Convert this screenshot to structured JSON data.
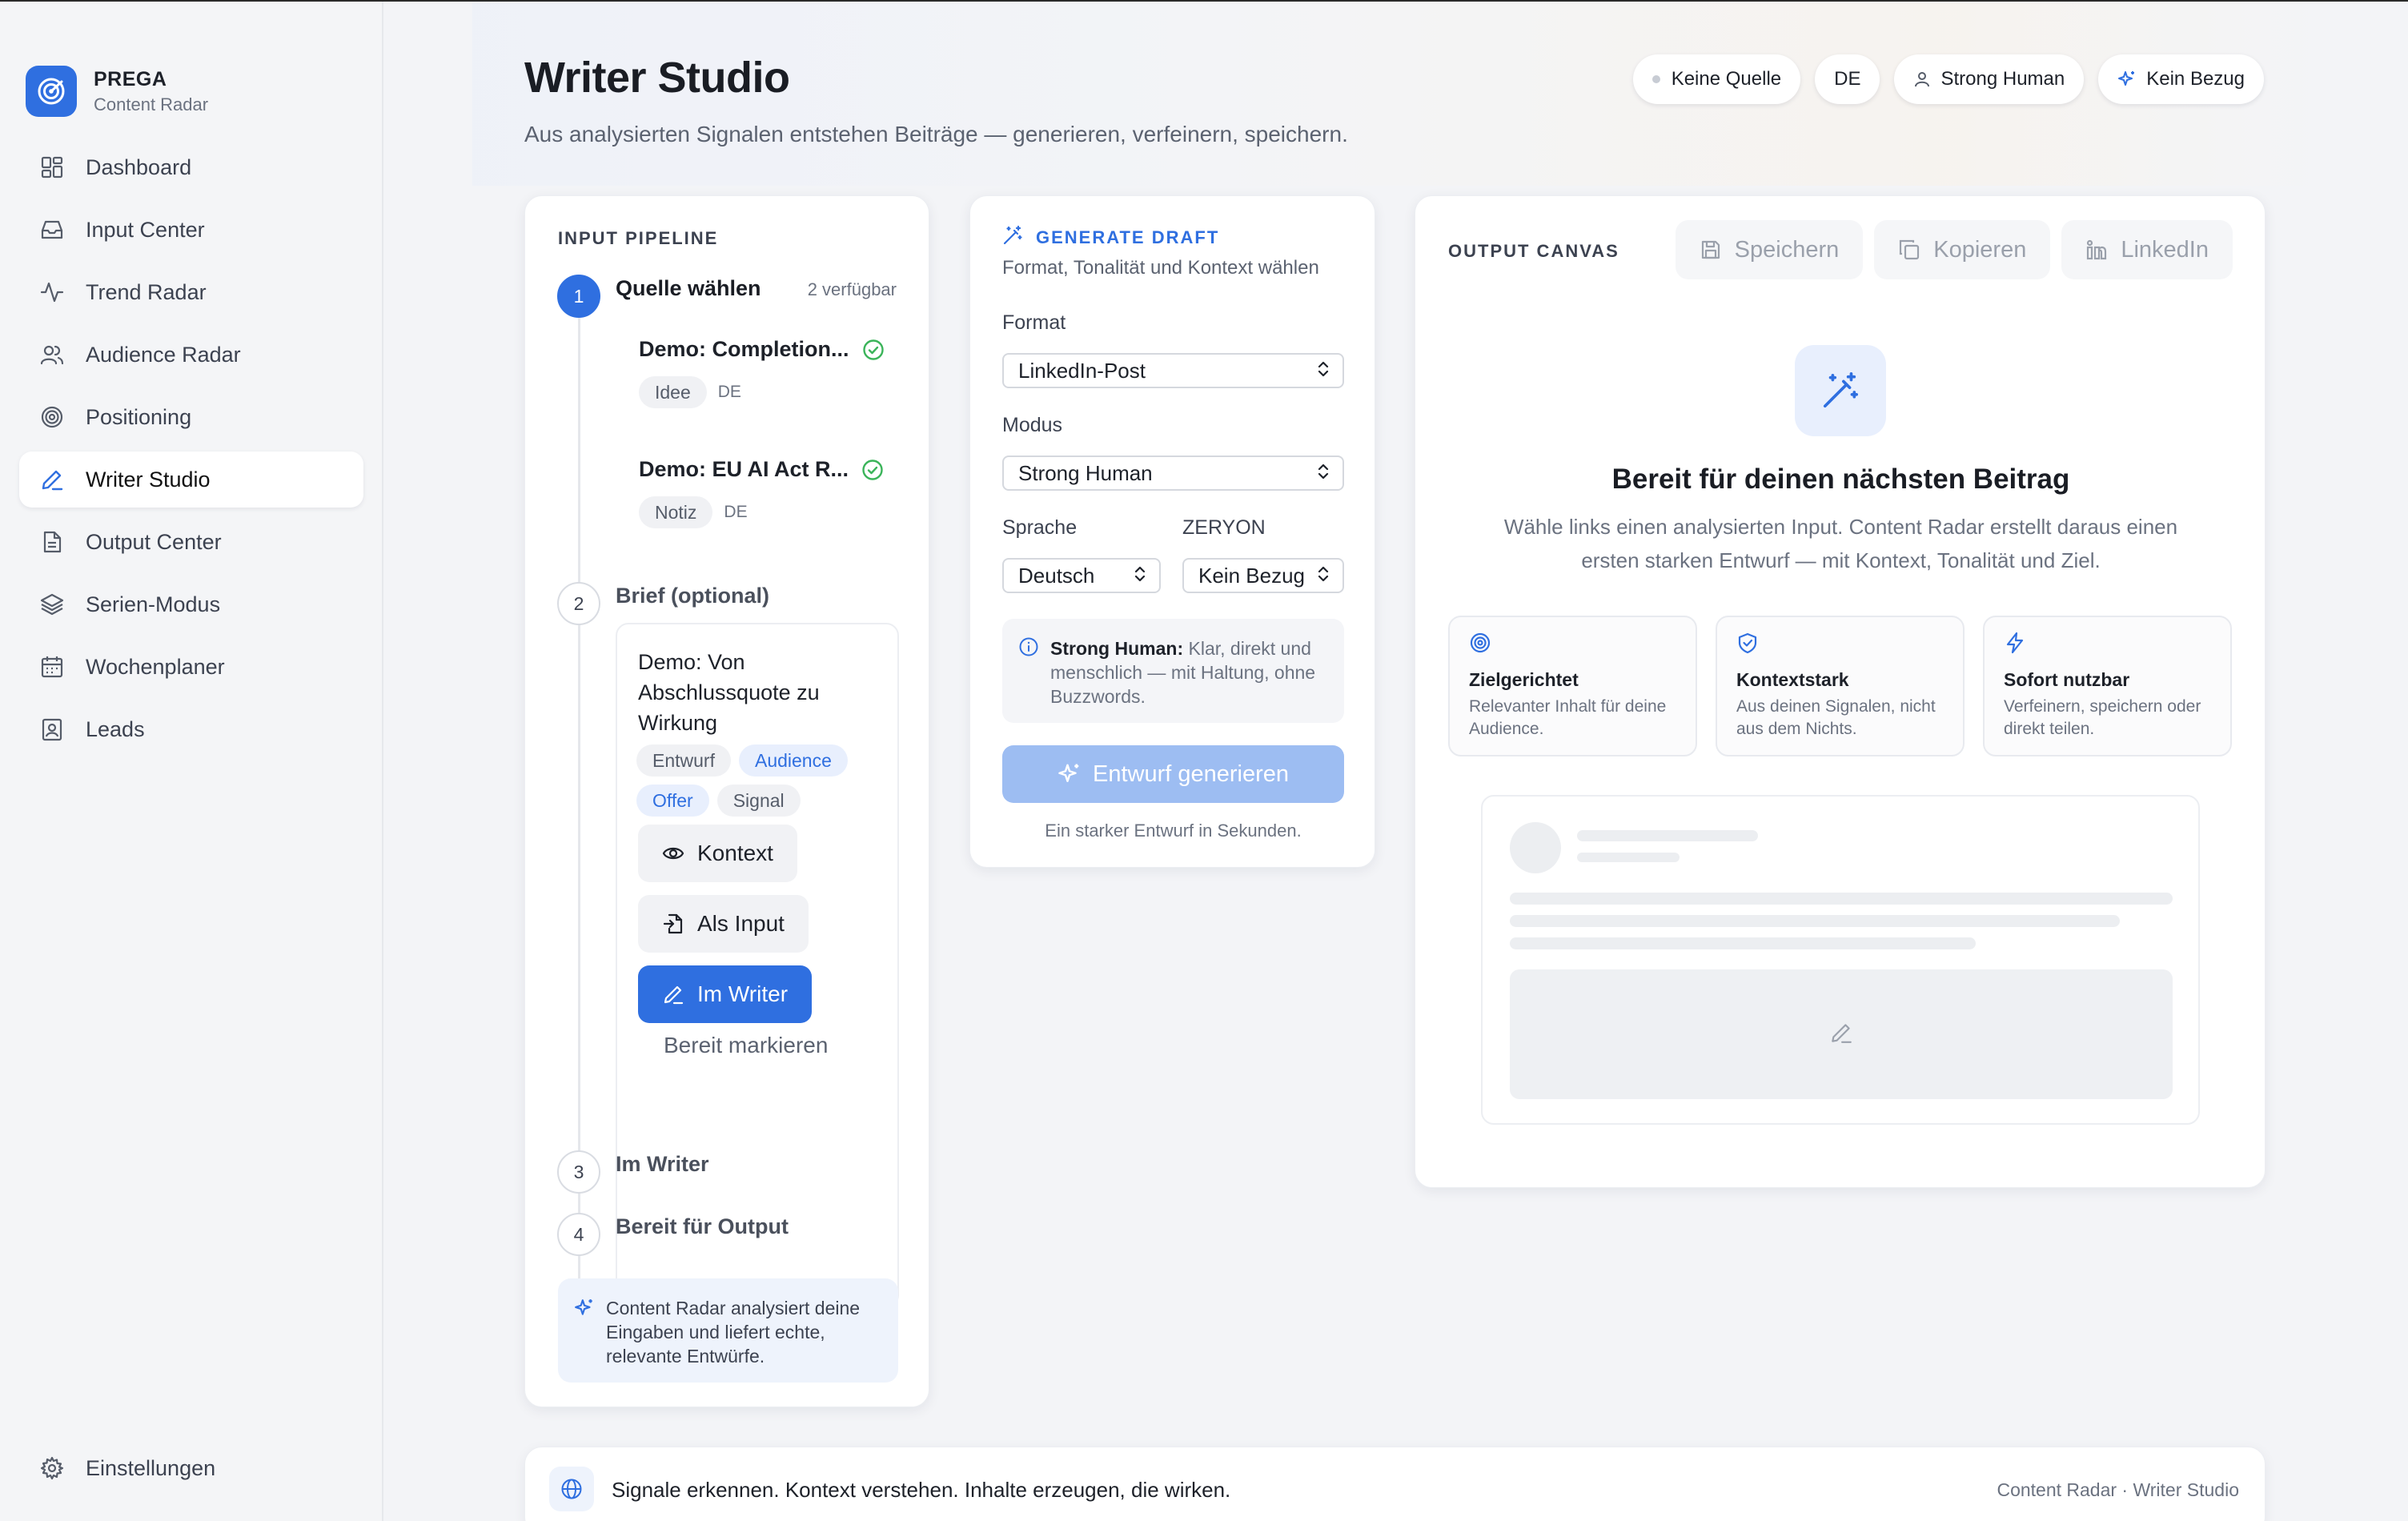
{
  "brand": {
    "name": "PREGA",
    "sub": "Content Radar"
  },
  "sidebar": {
    "items": [
      {
        "label": "Dashboard",
        "icon": "dashboard-icon"
      },
      {
        "label": "Input Center",
        "icon": "inbox-icon"
      },
      {
        "label": "Trend Radar",
        "icon": "activity-icon"
      },
      {
        "label": "Audience Radar",
        "icon": "users-icon"
      },
      {
        "label": "Positioning",
        "icon": "target-icon"
      },
      {
        "label": "Writer Studio",
        "icon": "pen-icon",
        "active": true
      },
      {
        "label": "Output Center",
        "icon": "document-icon"
      },
      {
        "label": "Serien-Modus",
        "icon": "layers-icon"
      },
      {
        "label": "Wochenplaner",
        "icon": "calendar-icon"
      },
      {
        "label": "Leads",
        "icon": "contact-icon"
      }
    ],
    "settings": "Einstellungen"
  },
  "header": {
    "title": "Writer Studio",
    "subtitle": "Aus analysierten Signalen entstehen Beiträge — generieren, verfeinern, speichern.",
    "chips": [
      "Keine Quelle",
      "DE",
      "Strong Human",
      "Kein Bezug"
    ]
  },
  "pipeline": {
    "label": "INPUT PIPELINE",
    "steps": [
      {
        "num": "1",
        "title": "Quelle wählen",
        "meta": "2 verfügbar"
      },
      {
        "num": "2",
        "title": "Brief (optional)"
      },
      {
        "num": "3",
        "title": "Im Writer"
      },
      {
        "num": "4",
        "title": "Bereit für Output"
      }
    ],
    "sources": [
      {
        "title": "Demo: Completion...",
        "tag": "Idee",
        "lang": "DE"
      },
      {
        "title": "Demo: EU AI Act R...",
        "tag": "Notiz",
        "lang": "DE"
      }
    ],
    "brief": {
      "title": "Demo: Von Abschlussquote zu Wirkung",
      "tags": [
        "Entwurf",
        "Audience",
        "Offer",
        "Signal"
      ],
      "btn_context": "Kontext",
      "btn_input": "Als Input",
      "btn_writer": "Im Writer",
      "btn_ready": "Bereit markieren"
    },
    "info": "Content Radar analysiert deine Eingaben und liefert echte, relevante Entwürfe."
  },
  "generate": {
    "label": "GENERATE DRAFT",
    "subtitle": "Format, Tonalität und Kontext wählen",
    "format_label": "Format",
    "format_value": "LinkedIn-Post",
    "mode_label": "Modus",
    "mode_value": "Strong Human",
    "lang_label": "Sprache",
    "lang_value": "Deutsch",
    "ref_label": "ZERYON",
    "ref_value": "Kein Bezug",
    "mode_info_bold": "Strong Human:",
    "mode_info_text": " Klar, direkt und menschlich — mit Haltung, ohne Buzzwords.",
    "button": "Entwurf generieren",
    "note": "Ein starker Entwurf in Sekunden."
  },
  "output": {
    "label": "OUTPUT CANVAS",
    "actions": [
      "Speichern",
      "Kopieren",
      "LinkedIn"
    ],
    "ready_title": "Bereit für deinen nächsten Beitrag",
    "ready_text": "Wähle links einen analysierten Input. Content Radar erstellt daraus einen ersten starken Entwurf — mit Kontext, Tonalität und Ziel.",
    "features": [
      {
        "title": "Zielgerichtet",
        "desc": "Relevanter Inhalt für deine Audience."
      },
      {
        "title": "Kontextstark",
        "desc": "Aus deinen Signalen, nicht aus dem Nichts."
      },
      {
        "title": "Sofort nutzbar",
        "desc": "Verfeinern, speichern oder direkt teilen."
      }
    ]
  },
  "footer": {
    "text": "Signale erkennen. Kontext verstehen. Inhalte erzeugen, die wirken.",
    "right": "Content Radar · Writer Studio"
  },
  "colors": {
    "accent": "#2f6fe0",
    "accent_light": "#e8effd",
    "success": "#3bb45a"
  }
}
